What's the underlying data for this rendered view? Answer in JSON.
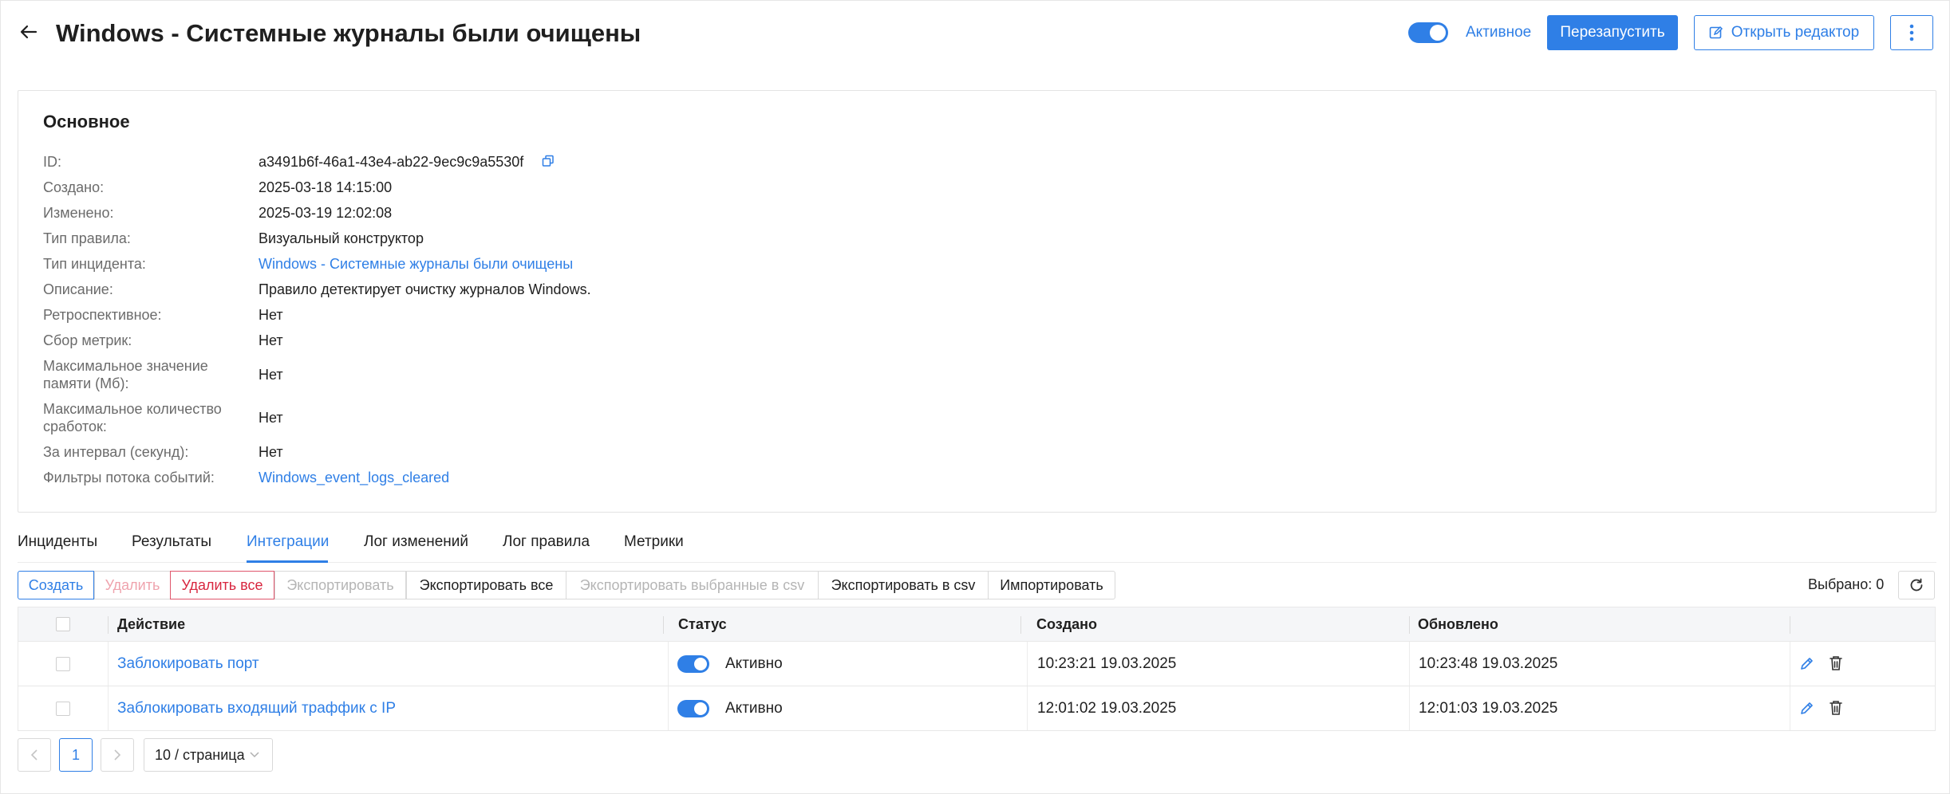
{
  "header": {
    "title": "Windows - Системные журналы были очищены",
    "active_label": "Активное",
    "restart_button": "Перезапустить",
    "open_editor_button": "Открыть редактор"
  },
  "info": {
    "section_title": "Основное",
    "rows": [
      {
        "label": "ID:",
        "value": "a3491b6f-46a1-43e4-ab22-9ec9c9a5530f"
      },
      {
        "label": "Создано:",
        "value": "2025-03-18 14:15:00"
      },
      {
        "label": "Изменено:",
        "value": "2025-03-19 12:02:08"
      },
      {
        "label": "Тип правила:",
        "value": "Визуальный конструктор"
      },
      {
        "label": "Тип инцидента:",
        "value": "Windows - Системные журналы были очищены"
      },
      {
        "label": "Описание:",
        "value": "Правило детектирует очистку журналов Windows."
      },
      {
        "label": "Ретроспективное:",
        "value": "Нет"
      },
      {
        "label": "Сбор метрик:",
        "value": "Нет"
      },
      {
        "label": "Максимальное значение памяти (Мб):",
        "value": "Нет"
      },
      {
        "label": "Максимальное количество сработок:",
        "value": "Нет"
      },
      {
        "label": "За интервал (секунд):",
        "value": "Нет"
      },
      {
        "label": "Фильтры потока событий:",
        "value": "Windows_event_logs_cleared"
      }
    ]
  },
  "tabs": [
    {
      "label": "Инциденты"
    },
    {
      "label": "Результаты"
    },
    {
      "label": "Интеграции",
      "active": true
    },
    {
      "label": "Лог изменений"
    },
    {
      "label": "Лог правила"
    },
    {
      "label": "Метрики"
    }
  ],
  "toolbar": {
    "create": "Создать",
    "delete": "Удалить",
    "delete_all": "Удалить все",
    "export": "Экспортировать",
    "export_all": "Экспортировать все",
    "export_selected_csv": "Экспортировать выбранные в csv",
    "export_csv": "Экспортировать в csv",
    "import": "Импортировать",
    "selected": "Выбрано: 0"
  },
  "table": {
    "columns": [
      "Действие",
      "Статус",
      "Создано",
      "Обновлено"
    ],
    "rows": [
      {
        "action": "Заблокировать порт",
        "status": "Активно",
        "created": "10:23:21 19.03.2025",
        "updated": "10:23:48 19.03.2025"
      },
      {
        "action": "Заблокировать входящий траффик с IP",
        "status": "Активно",
        "created": "12:01:02 19.03.2025",
        "updated": "12:01:03 19.03.2025"
      }
    ]
  },
  "pagination": {
    "current_page": "1",
    "page_size": "10 / страница"
  },
  "colors": {
    "accent": "#2f7fe6",
    "danger": "#d8263f"
  }
}
